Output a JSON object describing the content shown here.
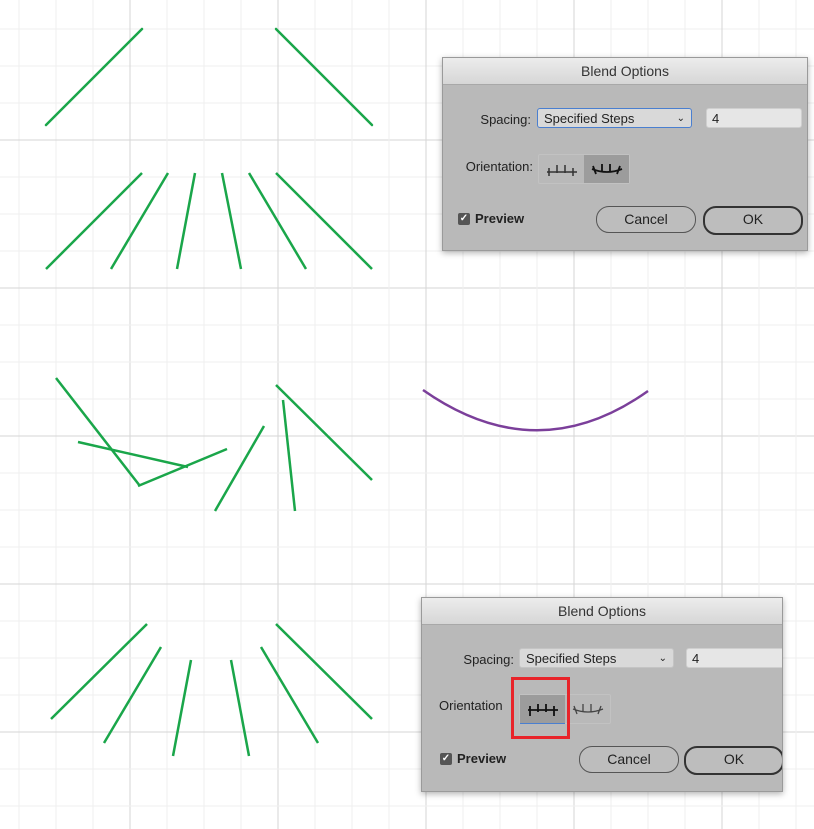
{
  "dialogs": [
    {
      "title": "Blend Options",
      "spacing_label": "Spacing:",
      "spacing_value": "Specified Steps",
      "steps_value": "4",
      "orientation_label": "Orientation:",
      "orientation_selected": "align-to-path",
      "preview_label": "Preview",
      "preview_checked": true,
      "cancel_label": "Cancel",
      "ok_label": "OK"
    },
    {
      "title": "Blend Options",
      "spacing_label": "Spacing:",
      "spacing_value": "Specified Steps",
      "steps_value": "4",
      "orientation_label": "Orientation",
      "orientation_selected": "align-to-page",
      "preview_label": "Preview",
      "preview_checked": true,
      "cancel_label": "Cancel",
      "ok_label": "OK",
      "highlight": "orientation-align-to-page"
    }
  ],
  "colors": {
    "blend_lines": "#1aa64a",
    "path": "#7b3f9a",
    "highlight": "#e8242a",
    "grid": "#e3e3e3"
  }
}
